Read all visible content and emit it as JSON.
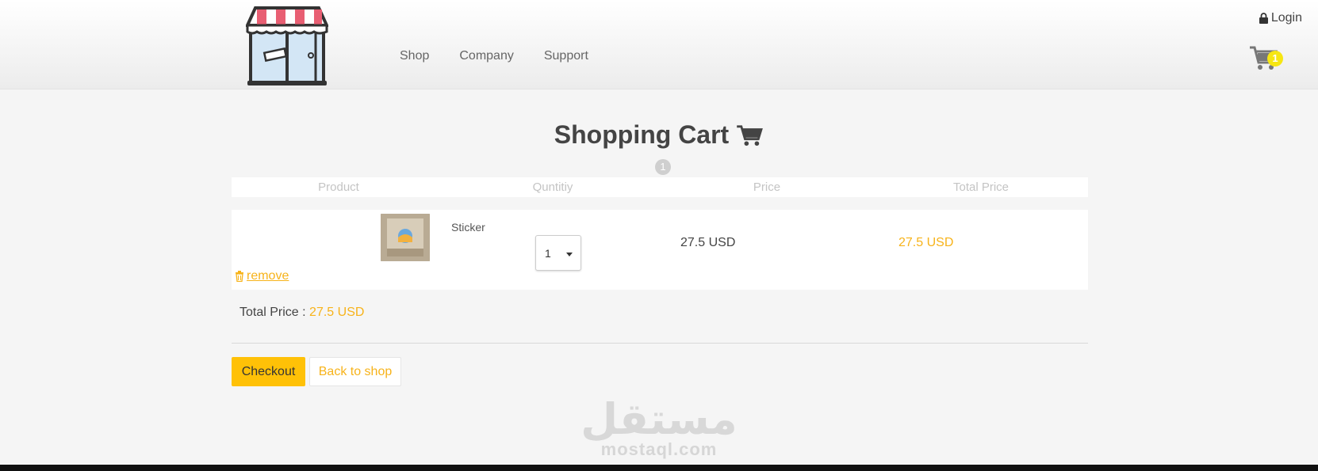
{
  "header": {
    "nav": [
      "Shop",
      "Company",
      "Support"
    ],
    "login_label": "Login",
    "cart_count": "1"
  },
  "page": {
    "title": "Shopping Cart",
    "item_count": "1"
  },
  "table": {
    "headers": [
      "Product",
      "Quntitiy",
      "Price",
      "Total Price"
    ],
    "rows": [
      {
        "product": "Sticker",
        "quantity": "1",
        "price": "27.5 USD",
        "total": "27.5 USD",
        "remove_label": "remove"
      }
    ]
  },
  "summary": {
    "total_label": "Total Price :",
    "total_value": "27.5 USD"
  },
  "actions": {
    "checkout_label": "Checkout",
    "back_label": "Back to shop"
  },
  "watermark": {
    "arabic": "مستقل",
    "latin": "mostaql.com"
  },
  "colors": {
    "accent": "#f7b31a",
    "button": "#ffc107",
    "badge": "#f6e612"
  }
}
